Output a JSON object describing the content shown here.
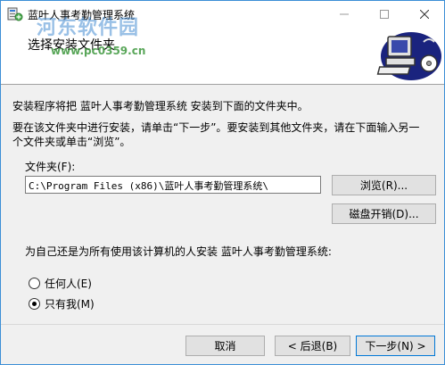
{
  "window": {
    "title": "蓝叶人事考勤管理系统",
    "icon": "installer-app-icon",
    "controls": {
      "minimize": "minimize-icon",
      "maximize": "maximize-icon",
      "close": "close-icon"
    }
  },
  "header": {
    "title": "选择安装文件夹",
    "image": "computer-install-illustration"
  },
  "watermark": {
    "site_name": "河东软件园",
    "url": "www.pc0359.cn"
  },
  "body": {
    "line1": "安装程序将把 蓝叶人事考勤管理系统 安装到下面的文件夹中。",
    "line2": "要在该文件夹中进行安装，请单击“下一步”。要安装到其他文件夹，请在下面输入另一",
    "line3": "个文件夹或单击“浏览”。"
  },
  "folder": {
    "label": "文件夹(F):",
    "value": "C:\\Program Files (x86)\\蓝叶人事考勤管理系统\\",
    "browse_label": "浏览(R)...",
    "disk_cost_label": "磁盘开销(D)..."
  },
  "install_for": {
    "question": "为自己还是为所有使用该计算机的人安装 蓝叶人事考勤管理系统:",
    "options": [
      {
        "label": "任何人(E)",
        "selected": false
      },
      {
        "label": "只有我(M)",
        "selected": true
      }
    ]
  },
  "footer": {
    "cancel_label": "取消",
    "back_label": "< 后退(B)",
    "next_label": "下一步(N) >"
  },
  "colors": {
    "accent": "#0078d7",
    "window_border": "#3c8fd6",
    "dialog_bg": "#f0f0f0",
    "watermark_blue": "#468cd2",
    "watermark_green": "#3c963c"
  }
}
